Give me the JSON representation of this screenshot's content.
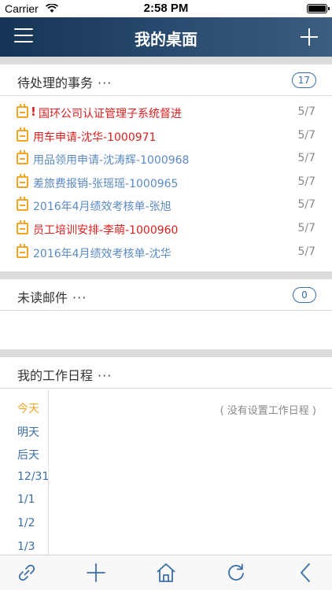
{
  "status_bar": {
    "carrier": "Carrier",
    "time": "2:58 PM"
  },
  "nav": {
    "title": "我的桌面",
    "menu_icon": "hamburger-menu-icon",
    "add_icon": "plus-icon"
  },
  "todo": {
    "label": "待处理的事务",
    "more": "···",
    "count": "17",
    "items": [
      {
        "title": "国环公司认证管理子系统督进",
        "date": "5/7",
        "color": "#d92020",
        "urgent": "!"
      },
      {
        "title": "用车申请-沈华-1000971",
        "date": "5/7",
        "color": "#d92020",
        "urgent": ""
      },
      {
        "title": "用品领用申请-沈涛辉-1000968",
        "date": "5/7",
        "color": "#5b8ac2",
        "urgent": ""
      },
      {
        "title": "差旅费报销-张瑶瑶-1000965",
        "date": "5/7",
        "color": "#5b8ac2",
        "urgent": ""
      },
      {
        "title": "2016年4月绩效考核单-张旭",
        "date": "5/7",
        "color": "#5b8ac2",
        "urgent": ""
      },
      {
        "title": "员工培训安排-李萌-1000960",
        "date": "5/7",
        "color": "#d92020",
        "urgent": ""
      },
      {
        "title": "2016年4月绩效考核单-沈华",
        "date": "5/7",
        "color": "#5b8ac2",
        "urgent": ""
      }
    ]
  },
  "mail": {
    "label": "未读邮件",
    "more": "···",
    "count": "0"
  },
  "schedule": {
    "label": "我的工作日程",
    "more": "···",
    "days": [
      "今天",
      "明天",
      "后天",
      "12/31",
      "1/1",
      "1/2",
      "1/3"
    ],
    "empty_text": "( 没有设置工作日程 )"
  },
  "tab_bar": {
    "icons": [
      "link-icon",
      "plus-icon",
      "home-icon",
      "refresh-icon",
      "back-icon"
    ],
    "icon_color": "#3b6ea8"
  }
}
